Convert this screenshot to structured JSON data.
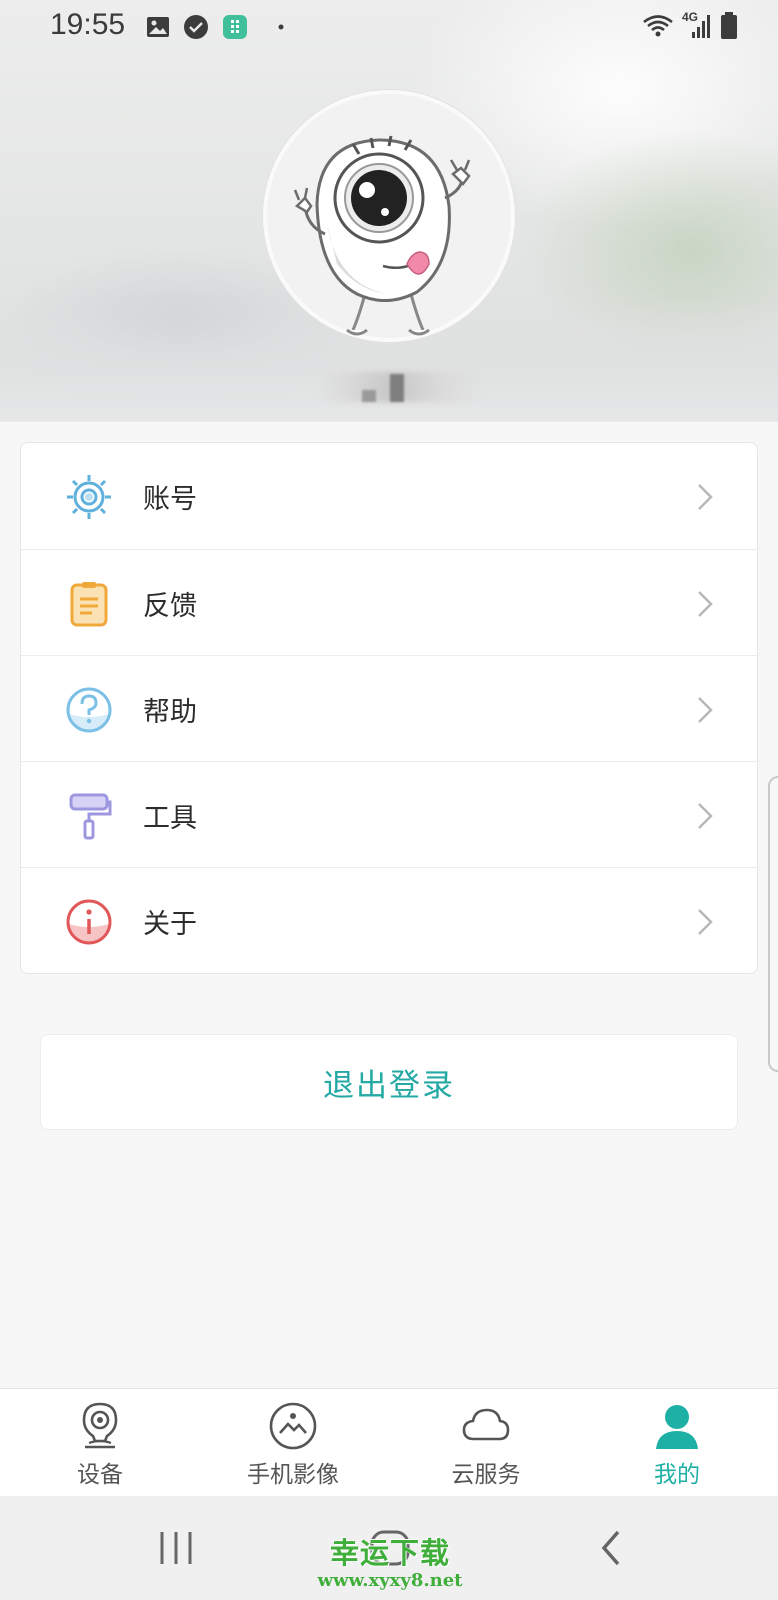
{
  "status_bar": {
    "time": "19:55",
    "network_label": "4G",
    "icons": [
      "gallery-icon",
      "clock-check-icon",
      "app-notification-icon",
      "dot-icon",
      "wifi-icon",
      "signal-icon",
      "battery-icon"
    ]
  },
  "profile": {
    "avatar": "cartoon-eyeball-avatar",
    "username": ""
  },
  "menu": {
    "items": [
      {
        "label": "账号",
        "icon": "account-gear-icon"
      },
      {
        "label": "反馈",
        "icon": "feedback-clipboard-icon"
      },
      {
        "label": "帮助",
        "icon": "help-question-icon"
      },
      {
        "label": "工具",
        "icon": "tool-roller-icon"
      },
      {
        "label": "关于",
        "icon": "about-info-icon"
      }
    ]
  },
  "logout": {
    "label": "退出登录"
  },
  "tabs": [
    {
      "label": "设备",
      "icon": "device-camera-icon",
      "active": false
    },
    {
      "label": "手机影像",
      "icon": "phone-image-icon",
      "active": false
    },
    {
      "label": "云服务",
      "icon": "cloud-icon",
      "active": false
    },
    {
      "label": "我的",
      "icon": "person-icon",
      "active": true
    }
  ],
  "watermark": {
    "title": "幸运下载",
    "url": "www.xyxy8.net"
  },
  "colors": {
    "accent": "#1fb0a5",
    "logout_text": "#25a9a4",
    "account_icon": "#5fb0dd",
    "feedback_icon": "#f0a83a",
    "help_icon": "#7cc0e6",
    "tool_icon": "#9d97e0",
    "about_icon": "#e0585a",
    "watermark": "#3fae3a"
  }
}
